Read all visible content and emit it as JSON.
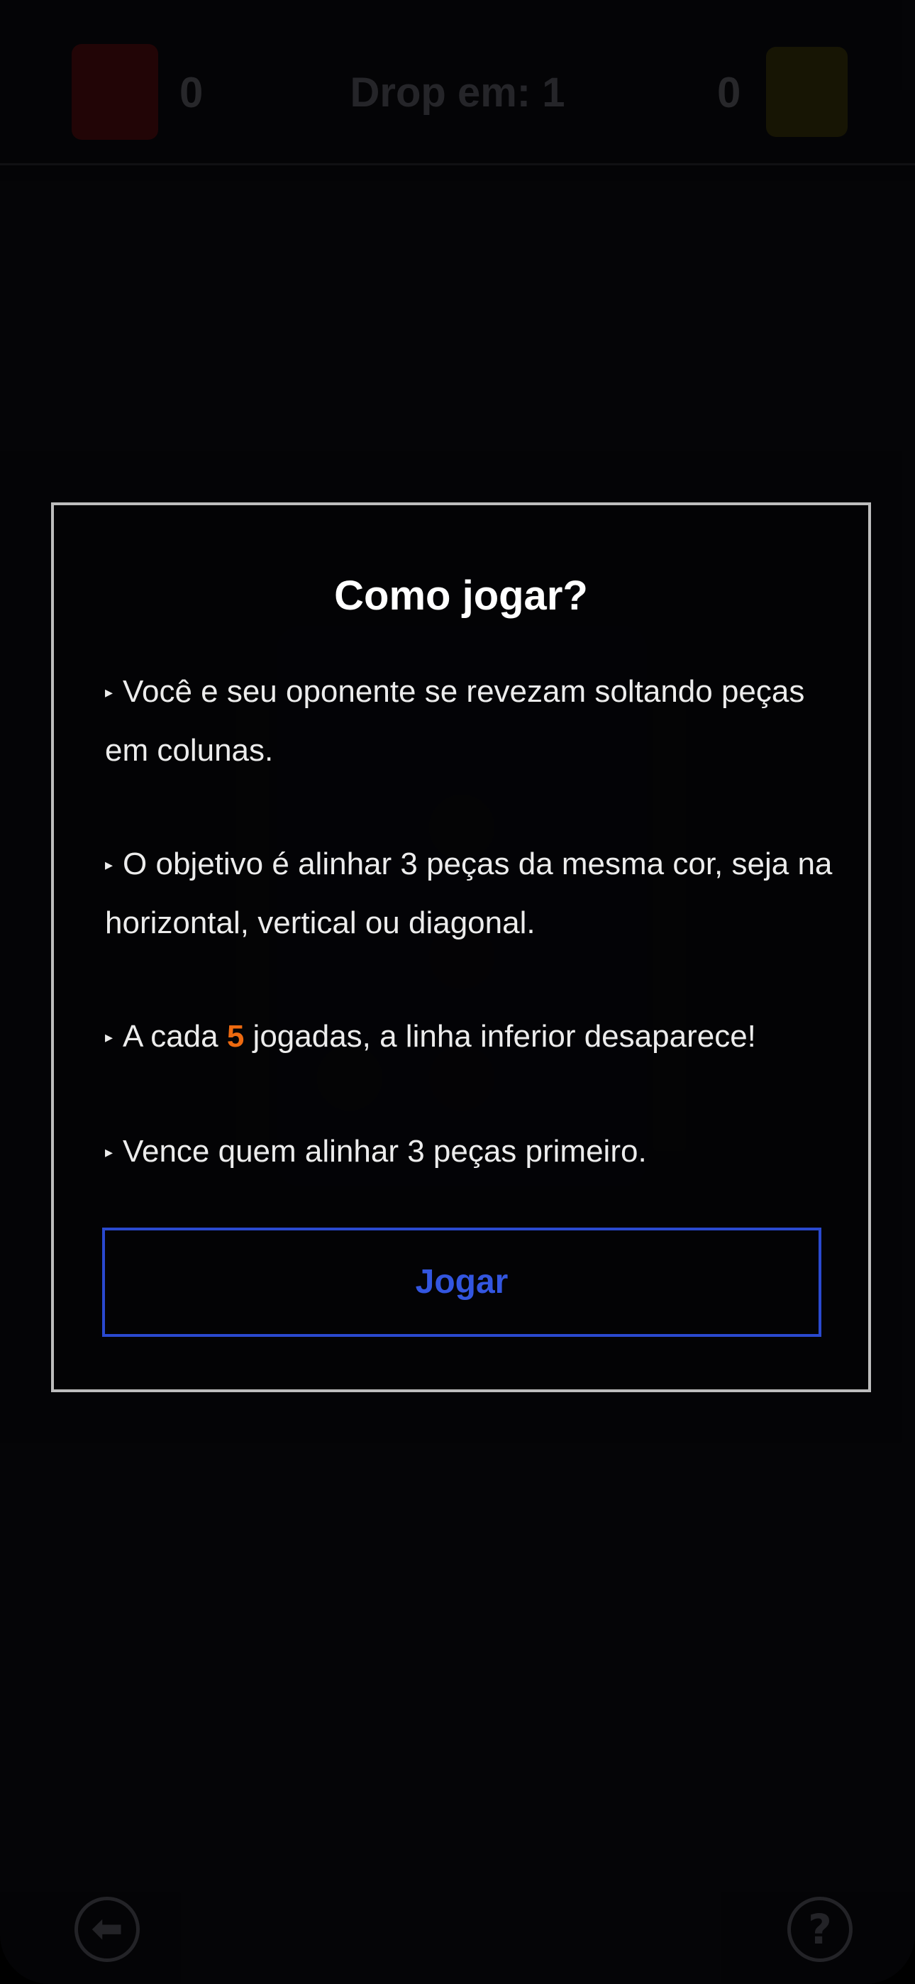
{
  "scoreboard": {
    "left_player_color": "#2a0708",
    "right_player_color": "#1d1a06",
    "left_score": "0",
    "right_score": "0",
    "drop_label": "Drop em: 1"
  },
  "board": {
    "board_color": "#070b1e",
    "pieces": [
      {
        "color": "yellow"
      },
      {
        "color": "red"
      },
      {
        "color": "yellow"
      },
      {
        "color": "red"
      }
    ]
  },
  "modal": {
    "title": "Como jogar?",
    "bullet": "▸",
    "rule_1": "Você e seu oponente se revezam soltando peças em colunas.",
    "rule_2": "O objetivo é alinhar 3 peças da mesma cor, seja na horizontal, vertical ou diagonal.",
    "rule_3_before": "A cada ",
    "rule_3_highlight": "5",
    "rule_3_after": " jogadas, a linha inferior desaparece!",
    "rule_4": "Vence quem alinhar 3 peças primeiro.",
    "play_button": "Jogar",
    "accent_color": "#2a49cf",
    "highlight_color": "#ee6a10"
  },
  "footer": {
    "back_icon": "arrow-left-circle-icon",
    "back_glyph": "⬅",
    "help_icon": "question-circle-icon",
    "help_glyph": "?"
  }
}
